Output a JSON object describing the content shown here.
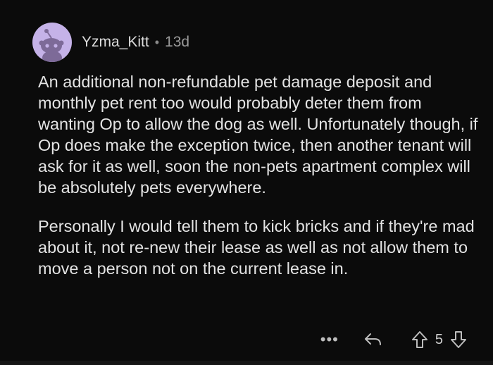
{
  "comment": {
    "author": "Yzma_Kitt",
    "separator": "•",
    "age": "13d",
    "paragraphs": [
      "An additional non-refundable pet damage deposit and monthly pet rent too would probably deter them from wanting Op to allow the dog as well. Unfortunately though, if Op does make the exception twice, then another tenant will ask for it as well, soon the non-pets apartment complex will be absolutely pets everywhere.",
      "Personally I would tell them to kick bricks and if they're mad about it, not re-new their lease as well as not allow them to move a person not on the current lease in."
    ]
  },
  "actions": {
    "more": "•••",
    "score": "5"
  },
  "colors": {
    "background": "#0b0b0b",
    "avatar_bg": "#c5b2e8",
    "text": "#e3e3e3",
    "muted": "#9a9a9a"
  },
  "icons": [
    "avatar-snoo-icon",
    "reply-icon",
    "upvote-icon",
    "downvote-icon",
    "more-icon"
  ]
}
